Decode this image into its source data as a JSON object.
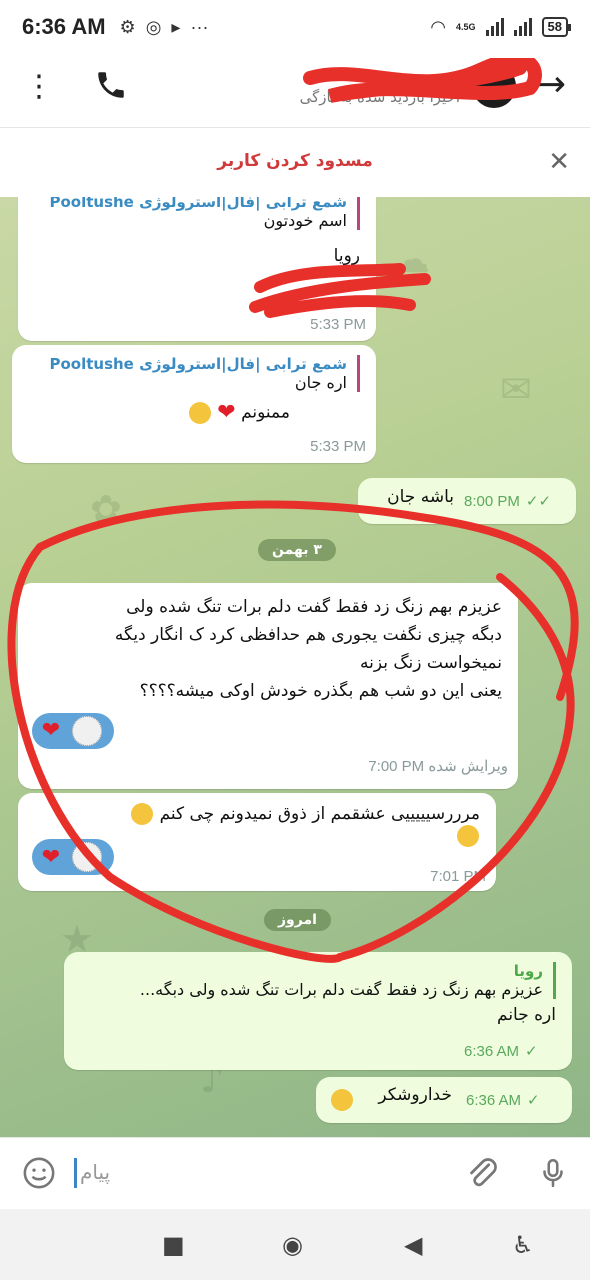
{
  "status": {
    "time": "6:36 AM",
    "net": "4.5G",
    "battery": "58"
  },
  "header": {
    "subtitle": "اخیراً بازدید شده به تازگی"
  },
  "block": {
    "label": "مسدود کردن کاربر"
  },
  "messages": [
    {
      "reply_name": "شمع ترابی |فال|استرولوژی Pooltushe",
      "reply_text": "اسم خودتون",
      "text": "رویا",
      "time": "5:33 PM"
    },
    {
      "reply_name": "شمع ترابی |فال|استرولوژی Pooltushe",
      "reply_text": "اره جان",
      "text": "ممنونم",
      "time": "5:33 PM"
    },
    {
      "text": "باشه جان",
      "time": "8:00 PM",
      "ticks": "✓✓"
    },
    {
      "date": "۳ بهمن"
    },
    {
      "line1": "عزیزم  بهم زنگ زد فقط گفت دلم برات تنگ شده ولی",
      "line2": "دبگه چیزی نگفت یجوری هم حدافظی کرد ک انگار دیگه",
      "line3": "نمیخواست زنگ بزنه",
      "line4": "یعنی این دو شب هم بگذره خودش اوکی میشه؟؟؟؟",
      "edited": "ویرایش شده",
      "time": "7:00 PM"
    },
    {
      "text": "مرررسیییییی عشقمم از ذوق نمیدونم چی کنم",
      "time": "7:01 PM"
    },
    {
      "date": "امروز"
    },
    {
      "reply_name": "رویا",
      "reply_text": "عزیزم  بهم زنگ زد فقط گفت دلم برات تنگ شده ولی دبگه...",
      "text": "اره جانم",
      "time": "6:36 AM",
      "ticks": "✓"
    },
    {
      "text": "خداروشکر",
      "time": "6:36 AM",
      "ticks": "✓"
    }
  ],
  "input": {
    "placeholder": "پیام"
  },
  "colors": {
    "accent": "#3d85c6",
    "block_red": "#d03a3a",
    "reply_pink": "#b9467f",
    "reply_green": "#53a84f",
    "annotation_red": "#e8302b"
  },
  "icons": [
    "kebab-icon",
    "phone-icon",
    "back-arrow-icon",
    "close-icon",
    "emoji-icon",
    "attach-icon",
    "mic-icon",
    "heart-icon"
  ]
}
